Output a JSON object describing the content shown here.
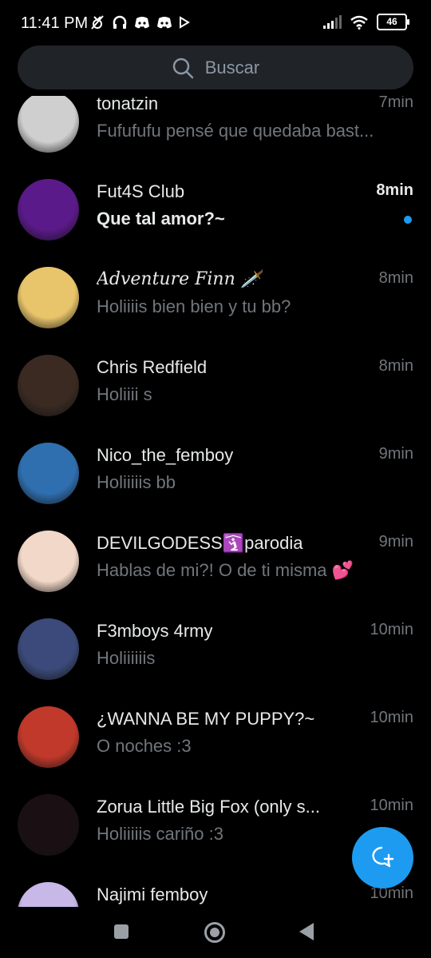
{
  "status_bar": {
    "time": "11:41 PM",
    "battery": "46",
    "icons_left": [
      "mute-icon",
      "headphones-icon",
      "discord-icon",
      "discord-icon",
      "play-icon"
    ],
    "icons_right": [
      "signal-icon",
      "wifi-icon",
      "battery-icon"
    ]
  },
  "search": {
    "placeholder": "Buscar"
  },
  "conversations": [
    {
      "name": "tonatzin",
      "time": "7min",
      "preview": "Fufufufu pensé que quedaba bast...",
      "unread": false,
      "avatar_color": "#cfcfcf"
    },
    {
      "name": "Fut4S Club",
      "time": "8min",
      "preview": "Que tal amor?~",
      "unread": true,
      "avatar_color": "#5b1a8a"
    },
    {
      "name": "Adventure Finn 🗡️",
      "time": "8min",
      "preview": "Holiiiis bien bien y tu bb?",
      "unread": false,
      "avatar_color": "#e8c46a"
    },
    {
      "name": "Chris Redfield",
      "time": "8min",
      "preview": "Holiiii s",
      "unread": false,
      "avatar_color": "#3a2a22"
    },
    {
      "name": "Nico_the_femboy",
      "time": "9min",
      "preview": "Holiiiiis bb",
      "unread": false,
      "avatar_color": "#2f6fb0"
    },
    {
      "name": "DEVILGODESS🛐parodia",
      "time": "9min",
      "preview": "Hablas de mi?! O de ti misma 💕",
      "unread": false,
      "avatar_color": "#f2d8c8"
    },
    {
      "name": "F3mboys 4rmy",
      "time": "10min",
      "preview": "Holiiiiiis",
      "unread": false,
      "avatar_color": "#3b4a7a"
    },
    {
      "name": "¿WANNA BE MY PUPPY?~",
      "time": "10min",
      "preview": "O noches :3",
      "unread": false,
      "avatar_color": "#c0392b"
    },
    {
      "name": "Zorua Little Big Fox (only s...",
      "time": "10min",
      "preview": "Holiiiiis cariño :3",
      "unread": false,
      "avatar_color": "#1a1014"
    },
    {
      "name": "Najimi femboy",
      "time": "10min",
      "preview": "",
      "unread": false,
      "avatar_color": "#c7b8e8"
    }
  ],
  "fab": {
    "icon": "new-message-icon"
  },
  "nav": {
    "icons": [
      "recents-icon",
      "home-icon",
      "back-icon"
    ]
  },
  "colors": {
    "accent": "#1d9bf0",
    "background": "#000000",
    "muted": "#71767b"
  }
}
